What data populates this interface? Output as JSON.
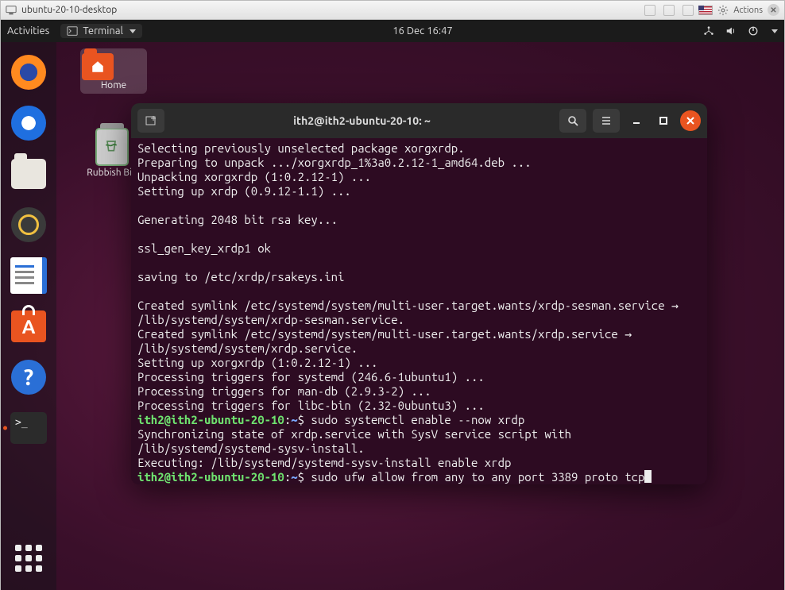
{
  "host": {
    "title": "ubuntu-20-10-desktop",
    "actions_label": "Actions"
  },
  "topbar": {
    "activities": "Activities",
    "app_name": "Terminal",
    "clock": "16 Dec  16:47"
  },
  "desktop_icons": {
    "home": "Home",
    "bin": "Rubbish Bin"
  },
  "terminal": {
    "title": "ith2@ith2-ubuntu-20-10: ~",
    "prompt_user": "ith2@ith2-ubuntu-20-10",
    "prompt_path": "~",
    "lines": [
      "Selecting previously unselected package xorgxrdp.",
      "Preparing to unpack .../xorgxrdp_1%3a0.2.12-1_amd64.deb ...",
      "Unpacking xorgxrdp (1:0.2.12-1) ...",
      "Setting up xrdp (0.9.12-1.1) ...",
      "",
      "Generating 2048 bit rsa key...",
      "",
      "ssl_gen_key_xrdp1 ok",
      "",
      "saving to /etc/xrdp/rsakeys.ini",
      "",
      "Created symlink /etc/systemd/system/multi-user.target.wants/xrdp-sesman.service → /lib/systemd/system/xrdp-sesman.service.",
      "Created symlink /etc/systemd/system/multi-user.target.wants/xrdp.service → /lib/systemd/system/xrdp.service.",
      "Setting up xorgxrdp (1:0.2.12-1) ...",
      "Processing triggers for systemd (246.6-1ubuntu1) ...",
      "Processing triggers for man-db (2.9.3-2) ...",
      "Processing triggers for libc-bin (2.32-0ubuntu3) ..."
    ],
    "cmd1": "sudo systemctl enable --now xrdp",
    "post_cmd1": [
      "Synchronizing state of xrdp.service with SysV service script with /lib/systemd/systemd-sysv-install.",
      "Executing: /lib/systemd/systemd-sysv-install enable xrdp"
    ],
    "cmd2": "sudo ufw allow from any to any port 3389 proto tcp"
  }
}
